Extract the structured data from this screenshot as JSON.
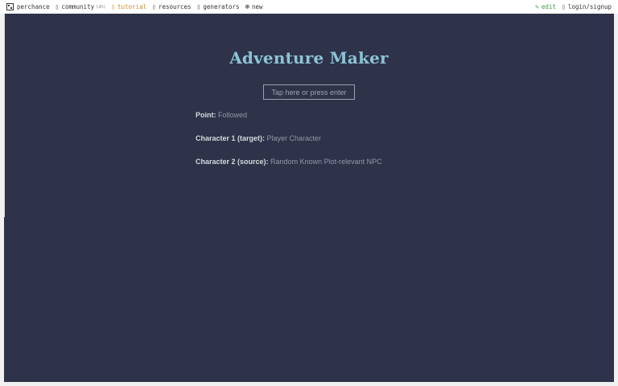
{
  "nav": {
    "left": [
      {
        "key": "perchance",
        "label": "perchance",
        "icon": "logo-icon"
      },
      {
        "key": "community",
        "label": "community",
        "badge": "(2h)",
        "icon": "chat-icon"
      },
      {
        "key": "tutorial",
        "label": "tutorial",
        "icon": "book-icon"
      },
      {
        "key": "resources",
        "label": "resources",
        "icon": "bookmark-icon"
      },
      {
        "key": "generators",
        "label": "generators",
        "icon": "grid-icon"
      },
      {
        "key": "new",
        "label": "new",
        "icon": "plus-circle-icon"
      }
    ],
    "right": [
      {
        "key": "edit",
        "label": "edit",
        "icon": "pencil-icon"
      },
      {
        "key": "login",
        "label": "login/signup",
        "icon": "user-icon"
      }
    ],
    "colors": {
      "tutorial": "#d08a2e",
      "edit": "#3c9a3c"
    }
  },
  "main": {
    "title": "Adventure Maker",
    "tap_button": "Tap here or press enter",
    "fields": [
      {
        "label": "Point:",
        "value": "Followed"
      },
      {
        "label": "Character 1 (target):",
        "value": "Player Character"
      },
      {
        "label": "Character 2 (source):",
        "value": "Random Known Plot-relevant NPC"
      }
    ],
    "colors": {
      "background": "#2f3349",
      "title": "#8cc4d6"
    }
  }
}
